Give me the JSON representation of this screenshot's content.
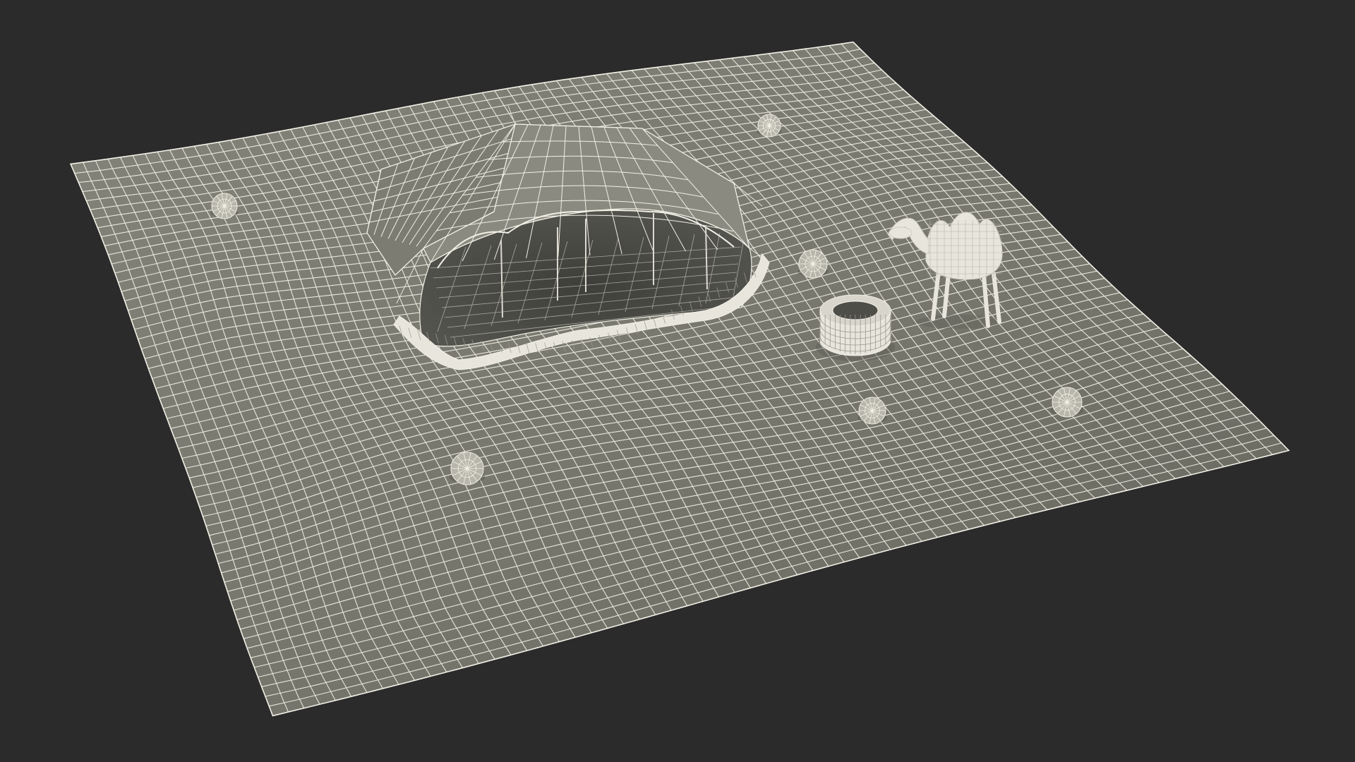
{
  "scene": {
    "objects": [
      {
        "name": "terrain-mesh"
      },
      {
        "name": "tent"
      },
      {
        "name": "well"
      },
      {
        "name": "camel"
      },
      {
        "name": "tumbleweed"
      }
    ]
  },
  "colors": {
    "background": "#2b2b2b",
    "terrain_fill": "#7a7a70",
    "terrain_fill_dark": "#62625a",
    "wire": "#f2f0e6",
    "model_fill": "#e8e6dc",
    "shadow": "#3a3a36"
  }
}
